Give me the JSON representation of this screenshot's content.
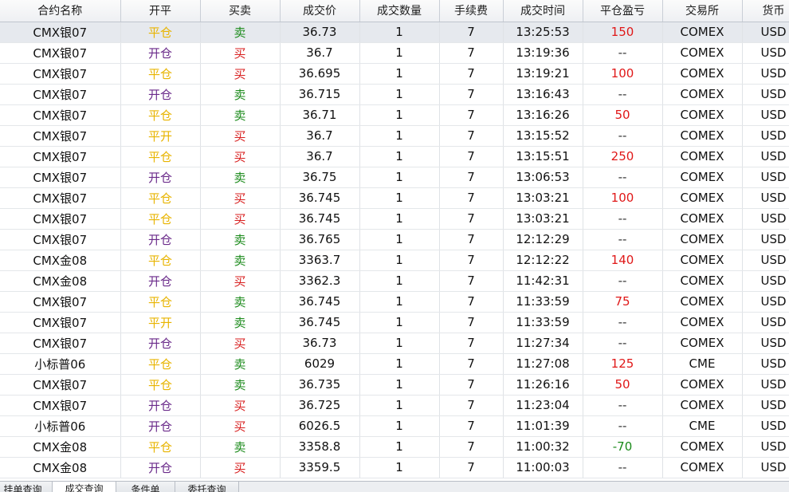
{
  "colors": {
    "open_close_ping": "#e8b400",
    "open_close_kai": "#6a2a8a",
    "side_sell": "#1a8a1a",
    "side_buy": "#d81e1e",
    "pnl_positive": "#e01818",
    "pnl_negative": "#1a8a1a",
    "pnl_none": "#333333"
  },
  "columns": [
    "合约名称",
    "开平",
    "买卖",
    "成交价",
    "成交数量",
    "手续费",
    "成交时间",
    "平仓盈亏",
    "交易所",
    "货币"
  ],
  "rows": [
    {
      "name": "CMX银07",
      "open_close": "平仓",
      "oc_type": "ping",
      "side": "卖",
      "side_type": "sell",
      "price": "36.73",
      "qty": "1",
      "fee": "7",
      "time": "13:25:53",
      "pnl": "150",
      "pnl_type": "positive",
      "exchange": "COMEX",
      "currency": "USD"
    },
    {
      "name": "CMX银07",
      "open_close": "开仓",
      "oc_type": "kai",
      "side": "买",
      "side_type": "buy",
      "price": "36.7",
      "qty": "1",
      "fee": "7",
      "time": "13:19:36",
      "pnl": "--",
      "pnl_type": "none",
      "exchange": "COMEX",
      "currency": "USD"
    },
    {
      "name": "CMX银07",
      "open_close": "平仓",
      "oc_type": "ping",
      "side": "买",
      "side_type": "buy",
      "price": "36.695",
      "qty": "1",
      "fee": "7",
      "time": "13:19:21",
      "pnl": "100",
      "pnl_type": "positive",
      "exchange": "COMEX",
      "currency": "USD"
    },
    {
      "name": "CMX银07",
      "open_close": "开仓",
      "oc_type": "kai",
      "side": "卖",
      "side_type": "sell",
      "price": "36.715",
      "qty": "1",
      "fee": "7",
      "time": "13:16:43",
      "pnl": "--",
      "pnl_type": "none",
      "exchange": "COMEX",
      "currency": "USD"
    },
    {
      "name": "CMX银07",
      "open_close": "平仓",
      "oc_type": "ping",
      "side": "卖",
      "side_type": "sell",
      "price": "36.71",
      "qty": "1",
      "fee": "7",
      "time": "13:16:26",
      "pnl": "50",
      "pnl_type": "positive",
      "exchange": "COMEX",
      "currency": "USD"
    },
    {
      "name": "CMX银07",
      "open_close": "平开",
      "oc_type": "ping",
      "side": "买",
      "side_type": "buy",
      "price": "36.7",
      "qty": "1",
      "fee": "7",
      "time": "13:15:52",
      "pnl": "--",
      "pnl_type": "none",
      "exchange": "COMEX",
      "currency": "USD"
    },
    {
      "name": "CMX银07",
      "open_close": "平仓",
      "oc_type": "ping",
      "side": "买",
      "side_type": "buy",
      "price": "36.7",
      "qty": "1",
      "fee": "7",
      "time": "13:15:51",
      "pnl": "250",
      "pnl_type": "positive",
      "exchange": "COMEX",
      "currency": "USD"
    },
    {
      "name": "CMX银07",
      "open_close": "开仓",
      "oc_type": "kai",
      "side": "卖",
      "side_type": "sell",
      "price": "36.75",
      "qty": "1",
      "fee": "7",
      "time": "13:06:53",
      "pnl": "--",
      "pnl_type": "none",
      "exchange": "COMEX",
      "currency": "USD"
    },
    {
      "name": "CMX银07",
      "open_close": "平仓",
      "oc_type": "ping",
      "side": "买",
      "side_type": "buy",
      "price": "36.745",
      "qty": "1",
      "fee": "7",
      "time": "13:03:21",
      "pnl": "100",
      "pnl_type": "positive",
      "exchange": "COMEX",
      "currency": "USD"
    },
    {
      "name": "CMX银07",
      "open_close": "平仓",
      "oc_type": "ping",
      "side": "买",
      "side_type": "buy",
      "price": "36.745",
      "qty": "1",
      "fee": "7",
      "time": "13:03:21",
      "pnl": "--",
      "pnl_type": "none",
      "exchange": "COMEX",
      "currency": "USD"
    },
    {
      "name": "CMX银07",
      "open_close": "开仓",
      "oc_type": "kai",
      "side": "卖",
      "side_type": "sell",
      "price": "36.765",
      "qty": "1",
      "fee": "7",
      "time": "12:12:29",
      "pnl": "--",
      "pnl_type": "none",
      "exchange": "COMEX",
      "currency": "USD"
    },
    {
      "name": "CMX金08",
      "open_close": "平仓",
      "oc_type": "ping",
      "side": "卖",
      "side_type": "sell",
      "price": "3363.7",
      "qty": "1",
      "fee": "7",
      "time": "12:12:22",
      "pnl": "140",
      "pnl_type": "positive",
      "exchange": "COMEX",
      "currency": "USD"
    },
    {
      "name": "CMX金08",
      "open_close": "开仓",
      "oc_type": "kai",
      "side": "买",
      "side_type": "buy",
      "price": "3362.3",
      "qty": "1",
      "fee": "7",
      "time": "11:42:31",
      "pnl": "--",
      "pnl_type": "none",
      "exchange": "COMEX",
      "currency": "USD"
    },
    {
      "name": "CMX银07",
      "open_close": "平仓",
      "oc_type": "ping",
      "side": "卖",
      "side_type": "sell",
      "price": "36.745",
      "qty": "1",
      "fee": "7",
      "time": "11:33:59",
      "pnl": "75",
      "pnl_type": "positive",
      "exchange": "COMEX",
      "currency": "USD"
    },
    {
      "name": "CMX银07",
      "open_close": "平开",
      "oc_type": "ping",
      "side": "卖",
      "side_type": "sell",
      "price": "36.745",
      "qty": "1",
      "fee": "7",
      "time": "11:33:59",
      "pnl": "--",
      "pnl_type": "none",
      "exchange": "COMEX",
      "currency": "USD"
    },
    {
      "name": "CMX银07",
      "open_close": "开仓",
      "oc_type": "kai",
      "side": "买",
      "side_type": "buy",
      "price": "36.73",
      "qty": "1",
      "fee": "7",
      "time": "11:27:34",
      "pnl": "--",
      "pnl_type": "none",
      "exchange": "COMEX",
      "currency": "USD"
    },
    {
      "name": "小标普06",
      "open_close": "平仓",
      "oc_type": "ping",
      "side": "卖",
      "side_type": "sell",
      "price": "6029",
      "qty": "1",
      "fee": "7",
      "time": "11:27:08",
      "pnl": "125",
      "pnl_type": "positive",
      "exchange": "CME",
      "currency": "USD"
    },
    {
      "name": "CMX银07",
      "open_close": "平仓",
      "oc_type": "ping",
      "side": "卖",
      "side_type": "sell",
      "price": "36.735",
      "qty": "1",
      "fee": "7",
      "time": "11:26:16",
      "pnl": "50",
      "pnl_type": "positive",
      "exchange": "COMEX",
      "currency": "USD"
    },
    {
      "name": "CMX银07",
      "open_close": "开仓",
      "oc_type": "kai",
      "side": "买",
      "side_type": "buy",
      "price": "36.725",
      "qty": "1",
      "fee": "7",
      "time": "11:23:04",
      "pnl": "--",
      "pnl_type": "none",
      "exchange": "COMEX",
      "currency": "USD"
    },
    {
      "name": "小标普06",
      "open_close": "开仓",
      "oc_type": "kai",
      "side": "买",
      "side_type": "buy",
      "price": "6026.5",
      "qty": "1",
      "fee": "7",
      "time": "11:01:39",
      "pnl": "--",
      "pnl_type": "none",
      "exchange": "CME",
      "currency": "USD"
    },
    {
      "name": "CMX金08",
      "open_close": "平仓",
      "oc_type": "ping",
      "side": "卖",
      "side_type": "sell",
      "price": "3358.8",
      "qty": "1",
      "fee": "7",
      "time": "11:00:32",
      "pnl": "-70",
      "pnl_type": "negative",
      "exchange": "COMEX",
      "currency": "USD"
    },
    {
      "name": "CMX金08",
      "open_close": "开仓",
      "oc_type": "kai",
      "side": "买",
      "side_type": "buy",
      "price": "3359.5",
      "qty": "1",
      "fee": "7",
      "time": "11:00:03",
      "pnl": "--",
      "pnl_type": "none",
      "exchange": "COMEX",
      "currency": "USD"
    }
  ],
  "tabs": [
    {
      "label": "挂单查询",
      "active": false
    },
    {
      "label": "成交查询",
      "active": true
    },
    {
      "label": "条件单",
      "active": false
    },
    {
      "label": "委托查询",
      "active": false
    }
  ]
}
